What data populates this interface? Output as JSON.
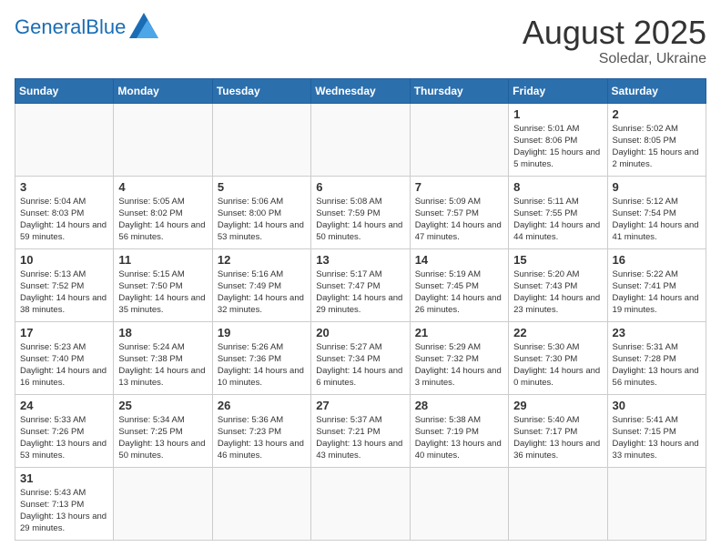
{
  "header": {
    "logo_general": "General",
    "logo_blue": "Blue",
    "month_title": "August 2025",
    "subtitle": "Soledar, Ukraine"
  },
  "days_of_week": [
    "Sunday",
    "Monday",
    "Tuesday",
    "Wednesday",
    "Thursday",
    "Friday",
    "Saturday"
  ],
  "weeks": [
    [
      {
        "day": "",
        "info": ""
      },
      {
        "day": "",
        "info": ""
      },
      {
        "day": "",
        "info": ""
      },
      {
        "day": "",
        "info": ""
      },
      {
        "day": "",
        "info": ""
      },
      {
        "day": "1",
        "info": "Sunrise: 5:01 AM\nSunset: 8:06 PM\nDaylight: 15 hours and 5 minutes."
      },
      {
        "day": "2",
        "info": "Sunrise: 5:02 AM\nSunset: 8:05 PM\nDaylight: 15 hours and 2 minutes."
      }
    ],
    [
      {
        "day": "3",
        "info": "Sunrise: 5:04 AM\nSunset: 8:03 PM\nDaylight: 14 hours and 59 minutes."
      },
      {
        "day": "4",
        "info": "Sunrise: 5:05 AM\nSunset: 8:02 PM\nDaylight: 14 hours and 56 minutes."
      },
      {
        "day": "5",
        "info": "Sunrise: 5:06 AM\nSunset: 8:00 PM\nDaylight: 14 hours and 53 minutes."
      },
      {
        "day": "6",
        "info": "Sunrise: 5:08 AM\nSunset: 7:59 PM\nDaylight: 14 hours and 50 minutes."
      },
      {
        "day": "7",
        "info": "Sunrise: 5:09 AM\nSunset: 7:57 PM\nDaylight: 14 hours and 47 minutes."
      },
      {
        "day": "8",
        "info": "Sunrise: 5:11 AM\nSunset: 7:55 PM\nDaylight: 14 hours and 44 minutes."
      },
      {
        "day": "9",
        "info": "Sunrise: 5:12 AM\nSunset: 7:54 PM\nDaylight: 14 hours and 41 minutes."
      }
    ],
    [
      {
        "day": "10",
        "info": "Sunrise: 5:13 AM\nSunset: 7:52 PM\nDaylight: 14 hours and 38 minutes."
      },
      {
        "day": "11",
        "info": "Sunrise: 5:15 AM\nSunset: 7:50 PM\nDaylight: 14 hours and 35 minutes."
      },
      {
        "day": "12",
        "info": "Sunrise: 5:16 AM\nSunset: 7:49 PM\nDaylight: 14 hours and 32 minutes."
      },
      {
        "day": "13",
        "info": "Sunrise: 5:17 AM\nSunset: 7:47 PM\nDaylight: 14 hours and 29 minutes."
      },
      {
        "day": "14",
        "info": "Sunrise: 5:19 AM\nSunset: 7:45 PM\nDaylight: 14 hours and 26 minutes."
      },
      {
        "day": "15",
        "info": "Sunrise: 5:20 AM\nSunset: 7:43 PM\nDaylight: 14 hours and 23 minutes."
      },
      {
        "day": "16",
        "info": "Sunrise: 5:22 AM\nSunset: 7:41 PM\nDaylight: 14 hours and 19 minutes."
      }
    ],
    [
      {
        "day": "17",
        "info": "Sunrise: 5:23 AM\nSunset: 7:40 PM\nDaylight: 14 hours and 16 minutes."
      },
      {
        "day": "18",
        "info": "Sunrise: 5:24 AM\nSunset: 7:38 PM\nDaylight: 14 hours and 13 minutes."
      },
      {
        "day": "19",
        "info": "Sunrise: 5:26 AM\nSunset: 7:36 PM\nDaylight: 14 hours and 10 minutes."
      },
      {
        "day": "20",
        "info": "Sunrise: 5:27 AM\nSunset: 7:34 PM\nDaylight: 14 hours and 6 minutes."
      },
      {
        "day": "21",
        "info": "Sunrise: 5:29 AM\nSunset: 7:32 PM\nDaylight: 14 hours and 3 minutes."
      },
      {
        "day": "22",
        "info": "Sunrise: 5:30 AM\nSunset: 7:30 PM\nDaylight: 14 hours and 0 minutes."
      },
      {
        "day": "23",
        "info": "Sunrise: 5:31 AM\nSunset: 7:28 PM\nDaylight: 13 hours and 56 minutes."
      }
    ],
    [
      {
        "day": "24",
        "info": "Sunrise: 5:33 AM\nSunset: 7:26 PM\nDaylight: 13 hours and 53 minutes."
      },
      {
        "day": "25",
        "info": "Sunrise: 5:34 AM\nSunset: 7:25 PM\nDaylight: 13 hours and 50 minutes."
      },
      {
        "day": "26",
        "info": "Sunrise: 5:36 AM\nSunset: 7:23 PM\nDaylight: 13 hours and 46 minutes."
      },
      {
        "day": "27",
        "info": "Sunrise: 5:37 AM\nSunset: 7:21 PM\nDaylight: 13 hours and 43 minutes."
      },
      {
        "day": "28",
        "info": "Sunrise: 5:38 AM\nSunset: 7:19 PM\nDaylight: 13 hours and 40 minutes."
      },
      {
        "day": "29",
        "info": "Sunrise: 5:40 AM\nSunset: 7:17 PM\nDaylight: 13 hours and 36 minutes."
      },
      {
        "day": "30",
        "info": "Sunrise: 5:41 AM\nSunset: 7:15 PM\nDaylight: 13 hours and 33 minutes."
      }
    ],
    [
      {
        "day": "31",
        "info": "Sunrise: 5:43 AM\nSunset: 7:13 PM\nDaylight: 13 hours and 29 minutes."
      },
      {
        "day": "",
        "info": ""
      },
      {
        "day": "",
        "info": ""
      },
      {
        "day": "",
        "info": ""
      },
      {
        "day": "",
        "info": ""
      },
      {
        "day": "",
        "info": ""
      },
      {
        "day": "",
        "info": ""
      }
    ]
  ]
}
